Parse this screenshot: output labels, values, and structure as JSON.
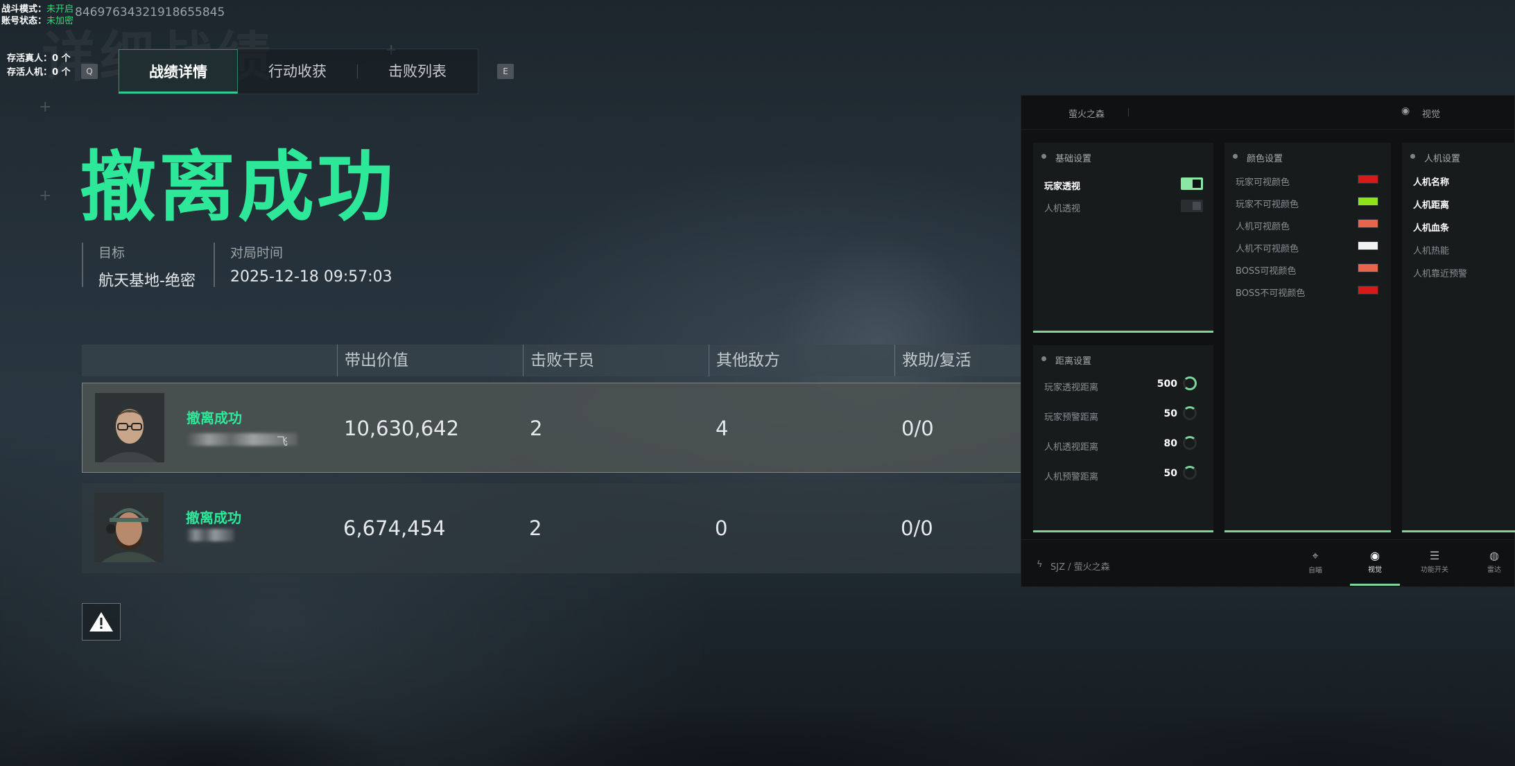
{
  "overlay": {
    "battle_mode_label": "战斗模式：",
    "battle_mode_value": "未开启",
    "account_status_label": "账号状态：",
    "account_status_value": "未加密",
    "id_number": "846976343219186558​45",
    "alive_players": "存活真人：0 个",
    "alive_bots": "存活人机：0 个"
  },
  "tabs": {
    "left_key": "Q",
    "right_key": "E",
    "items": [
      {
        "label": "战绩详情"
      },
      {
        "label": "行动收获"
      },
      {
        "label": "击败列表"
      }
    ]
  },
  "result": {
    "title": "撤离成功",
    "target_label": "目标",
    "target_value": "航天基地-绝密",
    "time_label": "对局时间",
    "time_value": "2025-12-18 09:57:03"
  },
  "table": {
    "columns": [
      "带出价值",
      "击败干员",
      "其他敌方",
      "救助/复活"
    ],
    "rows": [
      {
        "status": "撤离成功",
        "name_suffix": "飞",
        "value": "10,630,642",
        "kills": "2",
        "other": "4",
        "assist": "0/0"
      },
      {
        "status": "撤离成功",
        "name_suffix": "",
        "value": "6,674,454",
        "kills": "2",
        "other": "0",
        "assist": "0/0"
      }
    ]
  },
  "panel": {
    "title": "萤火之森",
    "right_title": "视觉",
    "basic": {
      "title": "基础设置",
      "options": [
        {
          "label": "玩家透视",
          "on": true
        },
        {
          "label": "人机透视",
          "on": false
        }
      ]
    },
    "colors": {
      "title": "颜色设置",
      "items": [
        {
          "label": "玩家可视颜色",
          "color": "#d61a1a"
        },
        {
          "label": "玩家不可视颜色",
          "color": "#8ee21a"
        },
        {
          "label": "人机可视颜色",
          "color": "#e8644c"
        },
        {
          "label": "人机不可视颜色",
          "color": "#f2f2f2"
        },
        {
          "label": "BOSS可视颜色",
          "color": "#e8644c"
        },
        {
          "label": "BOSS不可视颜色",
          "color": "#d61a1a"
        }
      ]
    },
    "bots": {
      "title": "人机设置",
      "options": [
        {
          "label": "人机名称",
          "on": true
        },
        {
          "label": "人机距离",
          "on": true
        },
        {
          "label": "人机血条",
          "on": true
        },
        {
          "label": "人机热能",
          "on": false
        },
        {
          "label": "人机靠近预警",
          "on": false
        }
      ]
    },
    "distance": {
      "title": "距离设置",
      "items": [
        {
          "label": "玩家透视距离",
          "value": "500",
          "level": 0.9
        },
        {
          "label": "玩家预警距离",
          "value": "50",
          "level": 0.25
        },
        {
          "label": "人机透视距离",
          "value": "80",
          "level": 0.15
        },
        {
          "label": "人机预警距离",
          "value": "50",
          "level": 0.12
        }
      ]
    },
    "footer": {
      "path": "SJZ / 萤火之森",
      "nav": [
        {
          "label": "自瞄",
          "icon": "crosshair-icon"
        },
        {
          "label": "视觉",
          "icon": "eye-icon"
        },
        {
          "label": "功能开关",
          "icon": "sliders-icon"
        },
        {
          "label": "雷达",
          "icon": "radar-icon"
        }
      ],
      "active_index": 1
    },
    "accent": "#7cd69a"
  }
}
